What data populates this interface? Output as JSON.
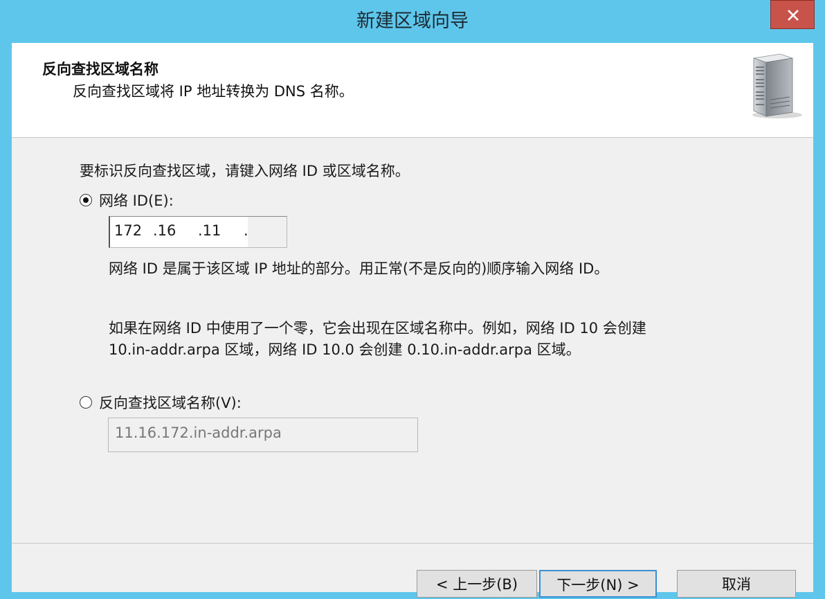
{
  "window": {
    "title": "新建区域向导",
    "close_glyph": "✕"
  },
  "header": {
    "title": "反向查找区域名称",
    "subtitle": "反向查找区域将 IP 地址转换为 DNS 名称。",
    "icon": "server-icon"
  },
  "body": {
    "instruction": "要标识反向查找区域，请键入网络 ID 或区域名称。",
    "option_network_id": {
      "label": "网络 ID(E):",
      "selected": true,
      "segments": [
        "172",
        ".16",
        ".11",
        "."
      ]
    },
    "network_id_desc": "网络 ID 是属于该区域 IP 地址的部分。用正常(不是反向的)顺序输入网络 ID。",
    "zero_desc_line1": "如果在网络 ID 中使用了一个零，它会出现在区域名称中。例如，网络 ID 10 会创建",
    "zero_desc_line2": "10.in-addr.arpa 区域，网络 ID 10.0 会创建 0.10.in-addr.arpa 区域。",
    "option_zone_name": {
      "label": "反向查找区域名称(V):",
      "selected": false,
      "value": "11.16.172.in-addr.arpa"
    }
  },
  "buttons": {
    "back": "< 上一步(B)",
    "next": "下一步(N) >",
    "cancel": "取消"
  }
}
